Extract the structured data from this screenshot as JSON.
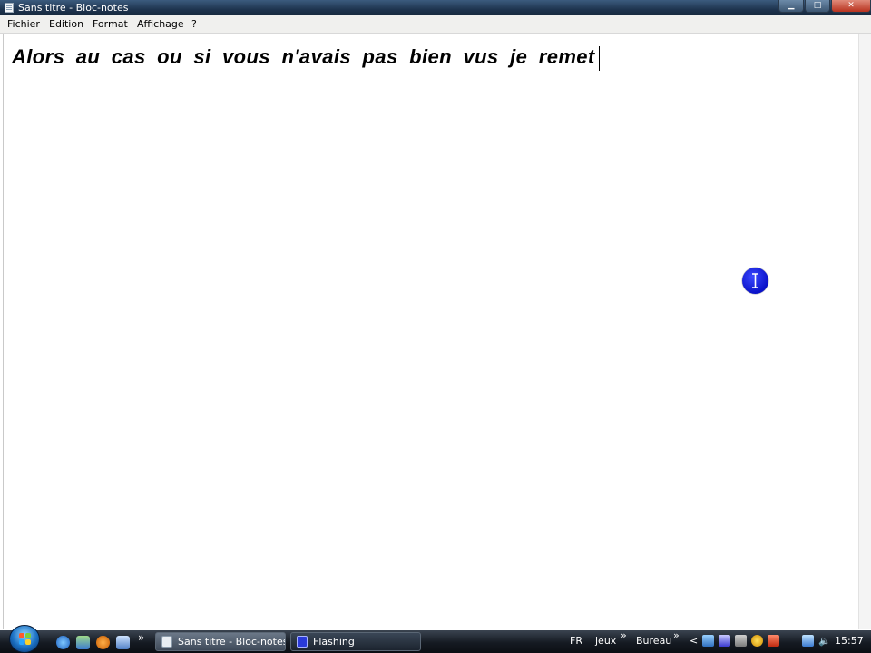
{
  "window": {
    "title": "Sans titre - Bloc-notes"
  },
  "menu": {
    "items": [
      "Fichier",
      "Edition",
      "Format",
      "Affichage",
      "?"
    ]
  },
  "editor": {
    "text": "Alors au cas ou si vous n'avais pas bien vus je remet"
  },
  "taskbar": {
    "tasks": [
      {
        "label": "Sans titre - Bloc-notes"
      },
      {
        "label": "Flashing"
      }
    ],
    "toolbars": [
      "jeux",
      "Bureau"
    ],
    "language": "FR",
    "clock": "15:57",
    "more_glyph": "»",
    "collapse_glyph": "<"
  },
  "colors": {
    "titlebar": "#1f3550",
    "cursor_indicator": "#0a12c8",
    "taskbar": "#151a22"
  },
  "icons": {
    "window_controls": [
      "minimize-icon",
      "maximize-icon",
      "close-icon"
    ],
    "quick_launch": [
      "internet-explorer-icon",
      "switch-windows-icon",
      "media-player-icon",
      "show-desktop-icon"
    ],
    "tray": [
      "network-icon",
      "security-icon",
      "app-icon",
      "shield-icon",
      "volume-icon"
    ]
  }
}
